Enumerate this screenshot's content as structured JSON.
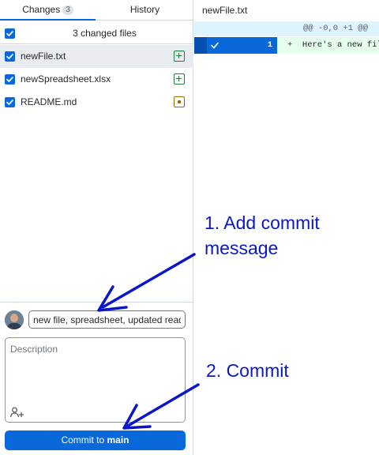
{
  "tabs": {
    "changes_label": "Changes",
    "changes_count": "3",
    "history_label": "History"
  },
  "changes": {
    "header_label": "3 changed files",
    "files": [
      {
        "name": "newFile.txt",
        "status": "added",
        "checked": true,
        "selected": true
      },
      {
        "name": "newSpreadsheet.xlsx",
        "status": "added",
        "checked": true,
        "selected": false
      },
      {
        "name": "README.md",
        "status": "modified",
        "checked": true,
        "selected": false
      }
    ]
  },
  "commit": {
    "summary_value": "new file, spreadsheet, updated readme",
    "description_placeholder": "Description",
    "button_prefix": "Commit to",
    "button_branch": "main"
  },
  "diff": {
    "file_title": "newFile.txt",
    "hunk_header": "@@ -0,0 +1 @@",
    "line_number": "1",
    "line_text": "+  Here's a new file"
  },
  "annotations": {
    "step1": "1. Add commit message",
    "step2": "2. Commit"
  },
  "colors": {
    "accent": "#0969da",
    "added": "#1a7f37",
    "modified": "#9a6700",
    "annotation": "#0a17c9"
  }
}
